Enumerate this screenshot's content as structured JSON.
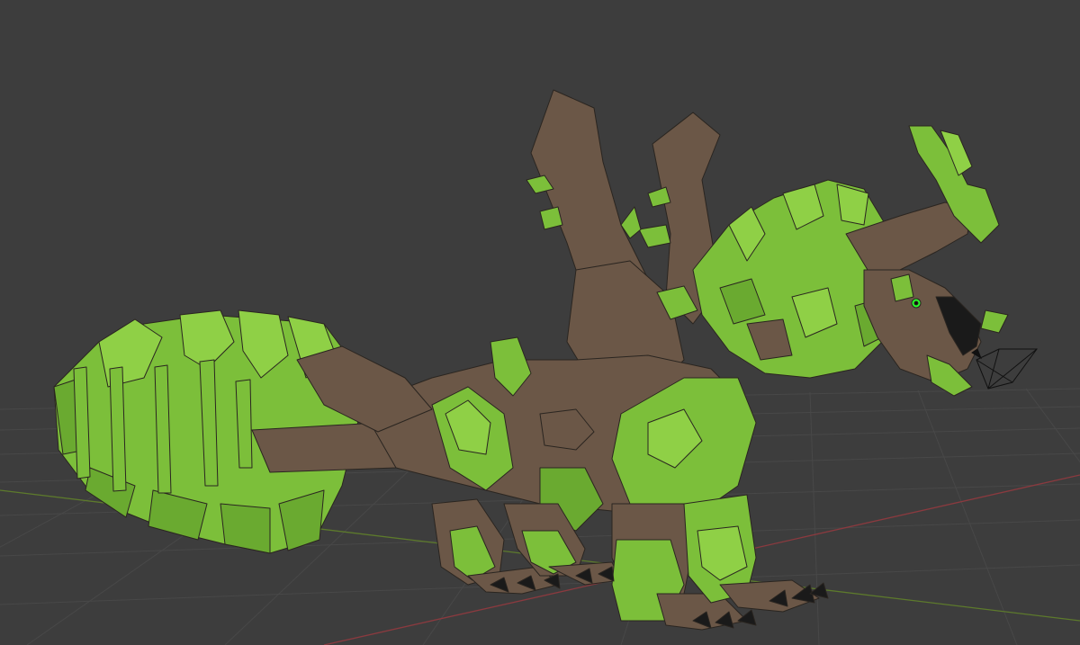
{
  "viewport": {
    "background_color": "#3d3d3d",
    "grid_color": "#484848",
    "x_axis_color": "#8a3a3f",
    "y_axis_color": "#5d7a2c"
  },
  "model": {
    "object": "green-leafy-dragon-creature",
    "palette": {
      "leaf_light": "#86c63e",
      "leaf_mid": "#6fae34",
      "leaf_dark": "#4f8a22",
      "bark": "#6b5747",
      "bark_dark": "#584637",
      "claw": "#1a1a1a",
      "outline": "#2a2520"
    }
  },
  "camera_gizmo": {
    "icon": "camera-icon",
    "color": "#111111"
  }
}
